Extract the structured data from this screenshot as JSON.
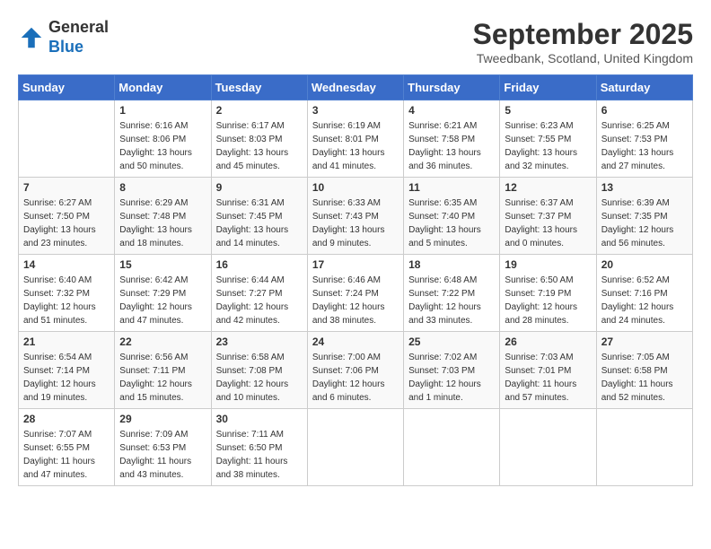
{
  "header": {
    "logo_line1": "General",
    "logo_line2": "Blue",
    "month_year": "September 2025",
    "location": "Tweedbank, Scotland, United Kingdom"
  },
  "days_of_week": [
    "Sunday",
    "Monday",
    "Tuesday",
    "Wednesday",
    "Thursday",
    "Friday",
    "Saturday"
  ],
  "weeks": [
    [
      {
        "day": "",
        "sunrise": "",
        "sunset": "",
        "daylight": ""
      },
      {
        "day": "1",
        "sunrise": "Sunrise: 6:16 AM",
        "sunset": "Sunset: 8:06 PM",
        "daylight": "Daylight: 13 hours and 50 minutes."
      },
      {
        "day": "2",
        "sunrise": "Sunrise: 6:17 AM",
        "sunset": "Sunset: 8:03 PM",
        "daylight": "Daylight: 13 hours and 45 minutes."
      },
      {
        "day": "3",
        "sunrise": "Sunrise: 6:19 AM",
        "sunset": "Sunset: 8:01 PM",
        "daylight": "Daylight: 13 hours and 41 minutes."
      },
      {
        "day": "4",
        "sunrise": "Sunrise: 6:21 AM",
        "sunset": "Sunset: 7:58 PM",
        "daylight": "Daylight: 13 hours and 36 minutes."
      },
      {
        "day": "5",
        "sunrise": "Sunrise: 6:23 AM",
        "sunset": "Sunset: 7:55 PM",
        "daylight": "Daylight: 13 hours and 32 minutes."
      },
      {
        "day": "6",
        "sunrise": "Sunrise: 6:25 AM",
        "sunset": "Sunset: 7:53 PM",
        "daylight": "Daylight: 13 hours and 27 minutes."
      }
    ],
    [
      {
        "day": "7",
        "sunrise": "Sunrise: 6:27 AM",
        "sunset": "Sunset: 7:50 PM",
        "daylight": "Daylight: 13 hours and 23 minutes."
      },
      {
        "day": "8",
        "sunrise": "Sunrise: 6:29 AM",
        "sunset": "Sunset: 7:48 PM",
        "daylight": "Daylight: 13 hours and 18 minutes."
      },
      {
        "day": "9",
        "sunrise": "Sunrise: 6:31 AM",
        "sunset": "Sunset: 7:45 PM",
        "daylight": "Daylight: 13 hours and 14 minutes."
      },
      {
        "day": "10",
        "sunrise": "Sunrise: 6:33 AM",
        "sunset": "Sunset: 7:43 PM",
        "daylight": "Daylight: 13 hours and 9 minutes."
      },
      {
        "day": "11",
        "sunrise": "Sunrise: 6:35 AM",
        "sunset": "Sunset: 7:40 PM",
        "daylight": "Daylight: 13 hours and 5 minutes."
      },
      {
        "day": "12",
        "sunrise": "Sunrise: 6:37 AM",
        "sunset": "Sunset: 7:37 PM",
        "daylight": "Daylight: 13 hours and 0 minutes."
      },
      {
        "day": "13",
        "sunrise": "Sunrise: 6:39 AM",
        "sunset": "Sunset: 7:35 PM",
        "daylight": "Daylight: 12 hours and 56 minutes."
      }
    ],
    [
      {
        "day": "14",
        "sunrise": "Sunrise: 6:40 AM",
        "sunset": "Sunset: 7:32 PM",
        "daylight": "Daylight: 12 hours and 51 minutes."
      },
      {
        "day": "15",
        "sunrise": "Sunrise: 6:42 AM",
        "sunset": "Sunset: 7:29 PM",
        "daylight": "Daylight: 12 hours and 47 minutes."
      },
      {
        "day": "16",
        "sunrise": "Sunrise: 6:44 AM",
        "sunset": "Sunset: 7:27 PM",
        "daylight": "Daylight: 12 hours and 42 minutes."
      },
      {
        "day": "17",
        "sunrise": "Sunrise: 6:46 AM",
        "sunset": "Sunset: 7:24 PM",
        "daylight": "Daylight: 12 hours and 38 minutes."
      },
      {
        "day": "18",
        "sunrise": "Sunrise: 6:48 AM",
        "sunset": "Sunset: 7:22 PM",
        "daylight": "Daylight: 12 hours and 33 minutes."
      },
      {
        "day": "19",
        "sunrise": "Sunrise: 6:50 AM",
        "sunset": "Sunset: 7:19 PM",
        "daylight": "Daylight: 12 hours and 28 minutes."
      },
      {
        "day": "20",
        "sunrise": "Sunrise: 6:52 AM",
        "sunset": "Sunset: 7:16 PM",
        "daylight": "Daylight: 12 hours and 24 minutes."
      }
    ],
    [
      {
        "day": "21",
        "sunrise": "Sunrise: 6:54 AM",
        "sunset": "Sunset: 7:14 PM",
        "daylight": "Daylight: 12 hours and 19 minutes."
      },
      {
        "day": "22",
        "sunrise": "Sunrise: 6:56 AM",
        "sunset": "Sunset: 7:11 PM",
        "daylight": "Daylight: 12 hours and 15 minutes."
      },
      {
        "day": "23",
        "sunrise": "Sunrise: 6:58 AM",
        "sunset": "Sunset: 7:08 PM",
        "daylight": "Daylight: 12 hours and 10 minutes."
      },
      {
        "day": "24",
        "sunrise": "Sunrise: 7:00 AM",
        "sunset": "Sunset: 7:06 PM",
        "daylight": "Daylight: 12 hours and 6 minutes."
      },
      {
        "day": "25",
        "sunrise": "Sunrise: 7:02 AM",
        "sunset": "Sunset: 7:03 PM",
        "daylight": "Daylight: 12 hours and 1 minute."
      },
      {
        "day": "26",
        "sunrise": "Sunrise: 7:03 AM",
        "sunset": "Sunset: 7:01 PM",
        "daylight": "Daylight: 11 hours and 57 minutes."
      },
      {
        "day": "27",
        "sunrise": "Sunrise: 7:05 AM",
        "sunset": "Sunset: 6:58 PM",
        "daylight": "Daylight: 11 hours and 52 minutes."
      }
    ],
    [
      {
        "day": "28",
        "sunrise": "Sunrise: 7:07 AM",
        "sunset": "Sunset: 6:55 PM",
        "daylight": "Daylight: 11 hours and 47 minutes."
      },
      {
        "day": "29",
        "sunrise": "Sunrise: 7:09 AM",
        "sunset": "Sunset: 6:53 PM",
        "daylight": "Daylight: 11 hours and 43 minutes."
      },
      {
        "day": "30",
        "sunrise": "Sunrise: 7:11 AM",
        "sunset": "Sunset: 6:50 PM",
        "daylight": "Daylight: 11 hours and 38 minutes."
      },
      {
        "day": "",
        "sunrise": "",
        "sunset": "",
        "daylight": ""
      },
      {
        "day": "",
        "sunrise": "",
        "sunset": "",
        "daylight": ""
      },
      {
        "day": "",
        "sunrise": "",
        "sunset": "",
        "daylight": ""
      },
      {
        "day": "",
        "sunrise": "",
        "sunset": "",
        "daylight": ""
      }
    ]
  ]
}
